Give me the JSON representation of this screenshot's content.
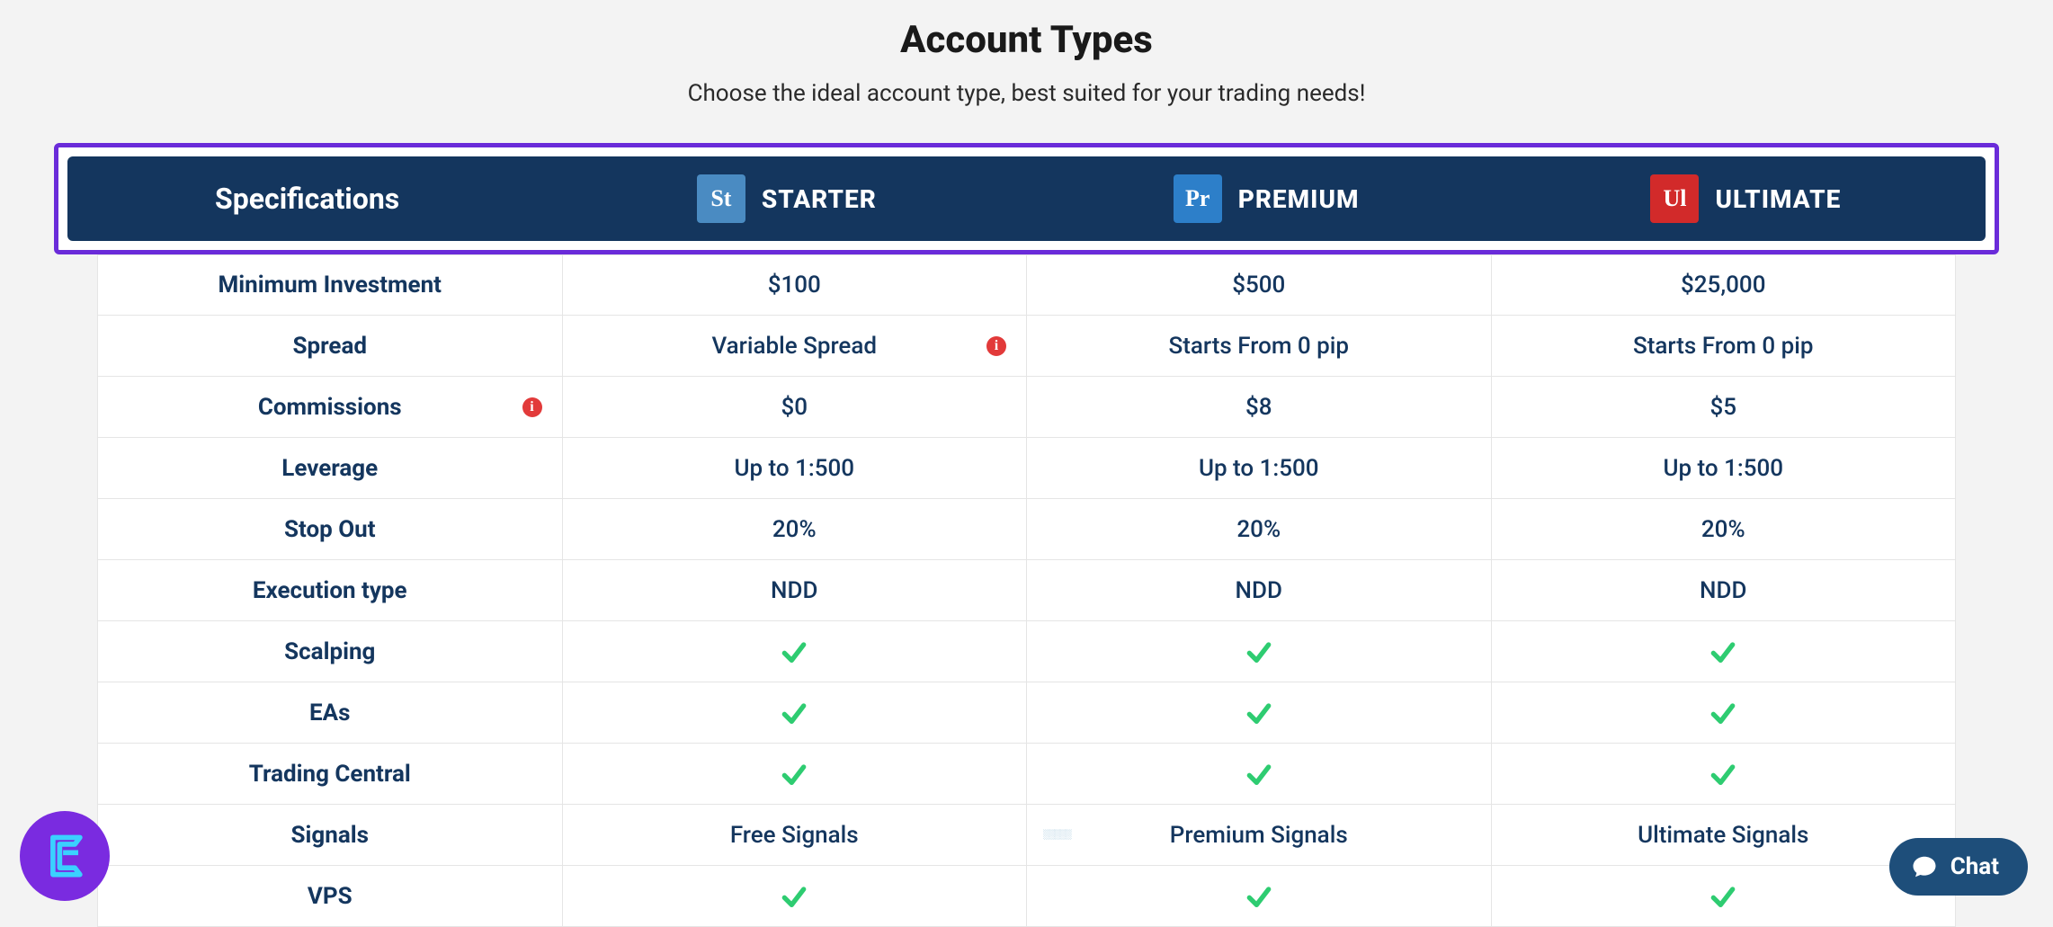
{
  "title": "Account Types",
  "subtitle": "Choose the ideal account type, best suited for your trading needs!",
  "header": {
    "spec_label": "Specifications",
    "tiers": [
      {
        "icon_text": "St",
        "label": "STARTER"
      },
      {
        "icon_text": "Pr",
        "label": "PREMIUM"
      },
      {
        "icon_text": "Ul",
        "label": "ULTIMATE"
      }
    ]
  },
  "rows": [
    {
      "spec": "Minimum Investment",
      "starter": "$100",
      "premium": "$500",
      "ultimate": "$25,000"
    },
    {
      "spec": "Spread",
      "starter": "Variable Spread",
      "premium": "Starts From 0 pip",
      "ultimate": "Starts From 0 pip",
      "info_on": "starter"
    },
    {
      "spec": "Commissions",
      "starter": "$0",
      "premium": "$8",
      "ultimate": "$5",
      "info_on": "spec"
    },
    {
      "spec": "Leverage",
      "starter": "Up to 1:500",
      "premium": "Up to 1:500",
      "ultimate": "Up to 1:500"
    },
    {
      "spec": "Stop Out",
      "starter": "20%",
      "premium": "20%",
      "ultimate": "20%"
    },
    {
      "spec": "Execution type",
      "starter": "NDD",
      "premium": "NDD",
      "ultimate": "NDD"
    },
    {
      "spec": "Scalping",
      "starter": "check",
      "premium": "check",
      "ultimate": "check"
    },
    {
      "spec": "EAs",
      "starter": "check",
      "premium": "check",
      "ultimate": "check"
    },
    {
      "spec": "Trading Central",
      "starter": "check",
      "premium": "check",
      "ultimate": "check"
    },
    {
      "spec": "Signals",
      "starter": "Free Signals",
      "premium": "Premium Signals",
      "ultimate": "Ultimate Signals"
    },
    {
      "spec": "VPS",
      "starter": "check",
      "premium": "check",
      "ultimate": "check"
    }
  ],
  "chat_label": "Chat"
}
